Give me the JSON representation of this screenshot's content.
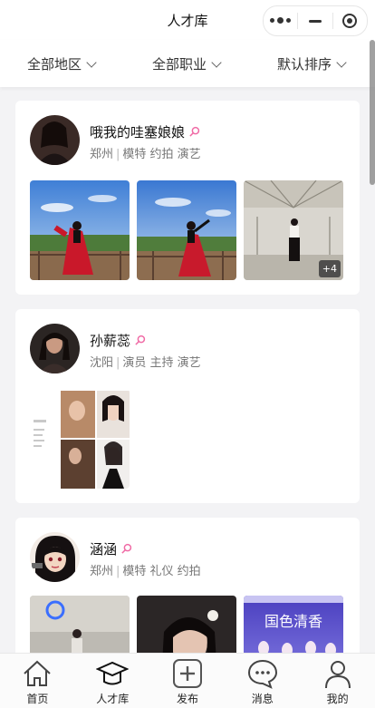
{
  "header": {
    "title": "人才库"
  },
  "filters": {
    "region": "全部地区",
    "job": "全部职业",
    "sort": "默认排序"
  },
  "profiles": [
    {
      "name": "哦我的哇塞娘娘",
      "city": "郑州",
      "tags": "模特 约拍 演艺",
      "photos": [
        "red-dress-boardwalk",
        "red-dress-boardwalk-2",
        "hall-standing"
      ],
      "more_count": "+4"
    },
    {
      "name": "孙薪蕊",
      "city": "沈阳",
      "tags": "演员 主持 演艺",
      "photos": [
        "composite-card"
      ]
    },
    {
      "name": "涵涵",
      "city": "郑州",
      "tags": "模特 礼仪 约拍",
      "photos": [
        "night-club",
        "selfie-dark",
        "stage-group"
      ],
      "photo3_text": "国色清香"
    }
  ],
  "tabbar": {
    "home": "首页",
    "talent": "人才库",
    "publish": "发布",
    "messages": "消息",
    "mine": "我的"
  },
  "colors": {
    "female_icon": "#f06aa5",
    "badge_bg": "#3c3c3c"
  }
}
